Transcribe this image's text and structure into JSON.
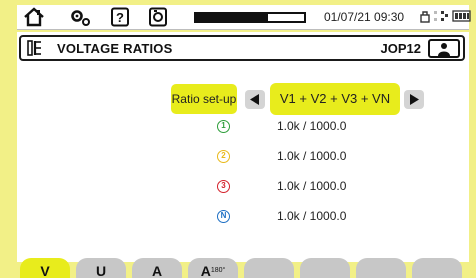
{
  "status_bar": {
    "icons": [
      "home-icon",
      "settings-icon",
      "help-icon",
      "camera-icon"
    ],
    "progress_fraction": 0.67,
    "datetime": "01/07/21 09:30",
    "tray_icons": [
      "lock-icon",
      "network-icon",
      "battery-icon"
    ]
  },
  "title_bar": {
    "icon": "ratio-icon",
    "title": "VOLTAGE RATIOS",
    "job_code": "JOP12",
    "user_icon": "user-icon"
  },
  "setup": {
    "button_label": "Ratio set-up",
    "selected_value": "V1 + V2 + V3 + VN"
  },
  "ratios": [
    {
      "phase": "1",
      "color": "#2e9e3a",
      "value": "1.0k / 1000.0"
    },
    {
      "phase": "2",
      "color": "#e9b91a",
      "value": "1.0k / 1000.0"
    },
    {
      "phase": "3",
      "color": "#d4212b",
      "value": "1.0k / 1000.0"
    },
    {
      "phase": "N",
      "color": "#1d6fc4",
      "value": "1.0k / 1000.0"
    }
  ],
  "tabs": [
    {
      "label": "V",
      "active": true
    },
    {
      "label": "U",
      "active": false
    },
    {
      "label": "A",
      "active": false
    },
    {
      "label": "A",
      "sup": "180°",
      "active": false
    },
    {
      "label": "",
      "active": false
    },
    {
      "label": "",
      "active": false
    },
    {
      "label": "",
      "active": false
    },
    {
      "label": "",
      "active": false
    }
  ],
  "colors": {
    "frame": "#f2f087",
    "accent": "#e8ec1c",
    "tab_inactive": "#c7c7c7"
  }
}
